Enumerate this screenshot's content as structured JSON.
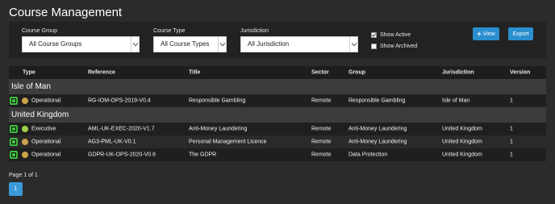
{
  "page": {
    "title": "Course Management"
  },
  "filters": {
    "course_group": {
      "label": "Course Group",
      "value": "All Course Groups"
    },
    "course_type": {
      "label": "Course Type",
      "value": "All Course Types"
    },
    "jurisdiction": {
      "label": "Jurisdiction",
      "value": "All Jurisdiction"
    },
    "show_active": {
      "label": "Show Active",
      "checked": true
    },
    "show_archived": {
      "label": "Show Archived",
      "checked": false
    }
  },
  "buttons": {
    "view": "View",
    "export": "Export"
  },
  "colors": {
    "accent": "#2b8fcf",
    "operational_dot": "#c9a24a",
    "executive_dot": "#9fcf4a",
    "icon_bg": "#3fbf3f"
  },
  "table": {
    "headers": [
      "Type",
      "Reference",
      "Title",
      "Sector",
      "Group",
      "Jurisdiction",
      "Version"
    ],
    "groups": [
      {
        "name": "Isle of Man",
        "rows": [
          {
            "type": "Operational",
            "reference": "RG-IOM-OPS-2019-V0.4",
            "title": "Responsible Gambling",
            "sector": "Remote",
            "group": "Responsible Gambling",
            "jurisdiction": "Isle of Man",
            "version": "1"
          }
        ]
      },
      {
        "name": "United Kingdom",
        "rows": [
          {
            "type": "Executive",
            "reference": "AML-UK-EXEC-2020-V1.7",
            "title": "Anti-Money Laundering",
            "sector": "Remote",
            "group": "Anti-Money Laundering",
            "jurisdiction": "United Kingdom",
            "version": "1"
          },
          {
            "type": "Operational",
            "reference": "AG3-PML-UK-V0.1",
            "title": "Personal Management Licence",
            "sector": "Remote",
            "group": "Anti-Money Laundering",
            "jurisdiction": "United Kingdom",
            "version": "1"
          },
          {
            "type": "Operational",
            "reference": "GDPR-UK-OPS-2020-V0.6",
            "title": "The GDPR",
            "sector": "Remote",
            "group": "Data Protection",
            "jurisdiction": "United Kingdom",
            "version": "1"
          }
        ]
      }
    ]
  },
  "pagination": {
    "summary": "Page 1 of 1",
    "current": "1"
  }
}
